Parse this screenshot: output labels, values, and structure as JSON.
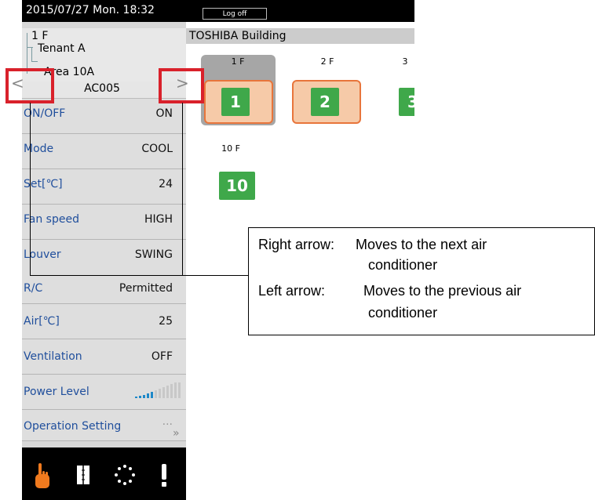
{
  "header": {
    "datetime": "2015/07/27 Mon. 18:32",
    "logoff_label": "Log off"
  },
  "tree": {
    "floor": "1 F",
    "tenant": "Tenant A",
    "area": "Area 10A"
  },
  "nav": {
    "prev_arrow": "<",
    "next_arrow": ">",
    "unit_name": "AC005"
  },
  "settings": [
    {
      "label": "ON/OFF",
      "value": "ON"
    },
    {
      "label": "Mode",
      "value": "COOL"
    },
    {
      "label": "Set[℃]",
      "value": "24"
    },
    {
      "label": "Fan speed",
      "value": "HIGH"
    },
    {
      "label": "Louver",
      "value": "SWING"
    },
    {
      "label": "R/C",
      "value": "Permitted"
    },
    {
      "label": "Air[℃]",
      "value": "25"
    },
    {
      "label": "Ventilation",
      "value": "OFF"
    },
    {
      "label": "Power Level",
      "value": ""
    },
    {
      "label": "Operation Setting",
      "value": "···"
    }
  ],
  "more_label": "»",
  "footer_icons": [
    "hand-pointer-icon",
    "schedule-book-icon",
    "loading-circle-icon",
    "alert-exclamation-icon"
  ],
  "building": {
    "name": "TOSHIBA Building"
  },
  "floors": [
    {
      "label": "1 F",
      "number": "1"
    },
    {
      "label": "2 F",
      "number": "2"
    },
    {
      "label": "3",
      "number": "3"
    },
    {
      "label": "10 F",
      "number": "10"
    }
  ],
  "callout": {
    "right_term": "Right arrow:",
    "right_desc_1": "Moves to the next air",
    "right_desc_2": "conditioner",
    "left_term": "Left arrow:",
    "left_desc_1": "Moves to the previous air",
    "left_desc_2": "conditioner"
  },
  "colors": {
    "accent_green": "#3fa84a",
    "tile_orange": "#e8753b",
    "label_blue": "#1f4e9c",
    "highlight_red": "#d9212b"
  }
}
